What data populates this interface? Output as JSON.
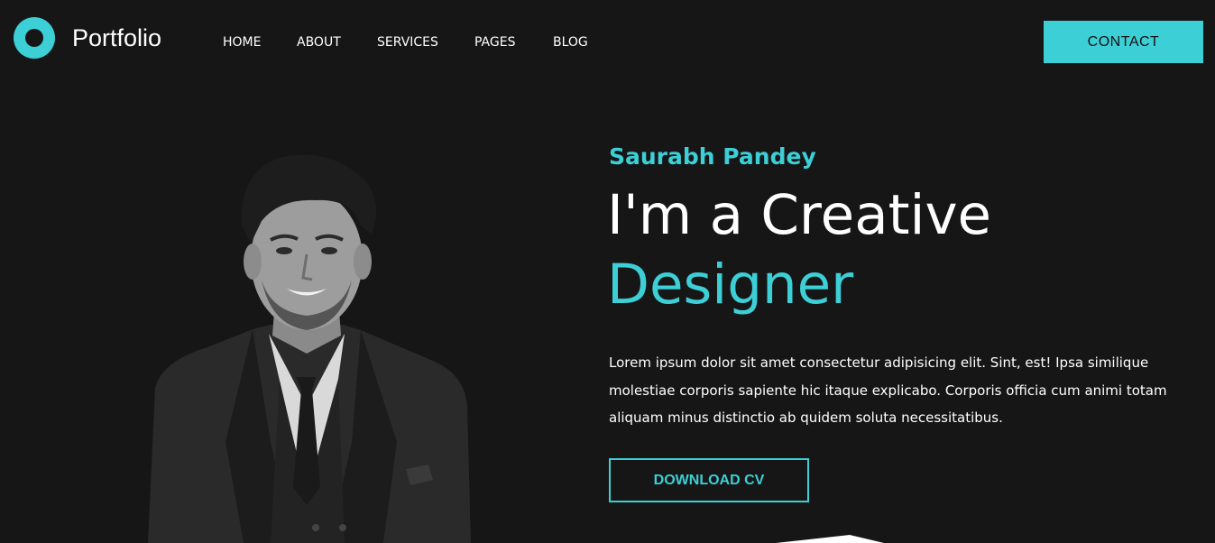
{
  "header": {
    "brand": "Portfolio",
    "nav": [
      "HOME",
      "ABOUT",
      "SERVICES",
      "PAGES",
      "BLOG"
    ],
    "contact_label": "CONTACT"
  },
  "hero": {
    "name": "Saurabh Pandey",
    "headline_line1": "I'm a Creative",
    "headline_line2": "Designer",
    "description": "Lorem ipsum dolor sit amet consectetur adipisicing elit. Sint, est! Ipsa similique molestiae corporis sapiente hic itaque explicabo. Corporis officia cum animi totam aliquam minus distinctio ab quidem soluta necessitatibus.",
    "download_label": "DOWNLOAD CV"
  },
  "colors": {
    "background": "#161616",
    "accent": "#3ccfd6",
    "text": "#ffffff"
  },
  "icons": {
    "logo": "ring-logo-icon"
  }
}
